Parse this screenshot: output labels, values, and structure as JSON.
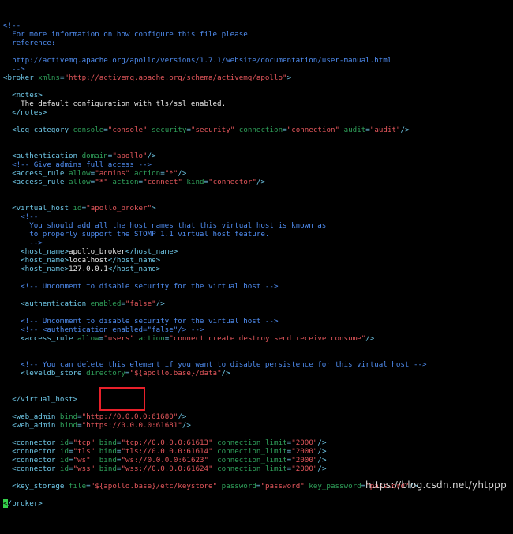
{
  "colors": {
    "background": "#000000",
    "comment": "#4f8cf0",
    "tag": "#6fc8e8",
    "attribute": "#2fa05a",
    "value": "#e4575c",
    "text": "#e6e6e6",
    "cursor": "#35d04a",
    "highlight_box": "#e8202a"
  },
  "lines": [
    [
      {
        "t": "<!--",
        "c": "comment"
      }
    ],
    [
      {
        "t": "  For more information on how configure this file please",
        "c": "comment"
      }
    ],
    [
      {
        "t": "  reference:",
        "c": "comment"
      }
    ],
    [],
    [
      {
        "t": "  http://activemq.apache.org/apollo/versions/1.7.1/website/documentation/user-manual.html",
        "c": "comment"
      }
    ],
    [
      {
        "t": "  -->",
        "c": "comment"
      }
    ],
    [
      {
        "t": "<broker ",
        "c": "tag"
      },
      {
        "t": "xmlns",
        "c": "attr"
      },
      {
        "t": "=",
        "c": "eq"
      },
      {
        "t": "\"http://activemq.apache.org/schema/activemq/apollo\"",
        "c": "val"
      },
      {
        "t": ">",
        "c": "tag"
      }
    ],
    [],
    [
      {
        "t": "  <notes>",
        "c": "tag"
      }
    ],
    [
      {
        "t": "    The default configuration with tls/ssl enabled.",
        "c": "text"
      }
    ],
    [
      {
        "t": "  </notes>",
        "c": "tag"
      }
    ],
    [],
    [
      {
        "t": "  <log_category ",
        "c": "tag"
      },
      {
        "t": "console",
        "c": "attr"
      },
      {
        "t": "=",
        "c": "eq"
      },
      {
        "t": "\"console\"",
        "c": "val"
      },
      {
        "t": " security",
        "c": "attr"
      },
      {
        "t": "=",
        "c": "eq"
      },
      {
        "t": "\"security\"",
        "c": "val"
      },
      {
        "t": " connection",
        "c": "attr"
      },
      {
        "t": "=",
        "c": "eq"
      },
      {
        "t": "\"connection\"",
        "c": "val"
      },
      {
        "t": " audit",
        "c": "attr"
      },
      {
        "t": "=",
        "c": "eq"
      },
      {
        "t": "\"audit\"",
        "c": "val"
      },
      {
        "t": "/>",
        "c": "tag"
      }
    ],
    [],
    [],
    [
      {
        "t": "  <authentication ",
        "c": "tag"
      },
      {
        "t": "domain",
        "c": "attr"
      },
      {
        "t": "=",
        "c": "eq"
      },
      {
        "t": "\"apollo\"",
        "c": "val"
      },
      {
        "t": "/>",
        "c": "tag"
      }
    ],
    [
      {
        "t": "  <!-- Give admins full access -->",
        "c": "comment"
      }
    ],
    [
      {
        "t": "  <access_rule ",
        "c": "tag"
      },
      {
        "t": "allow",
        "c": "attr"
      },
      {
        "t": "=",
        "c": "eq"
      },
      {
        "t": "\"admins\"",
        "c": "val"
      },
      {
        "t": " action",
        "c": "attr"
      },
      {
        "t": "=",
        "c": "eq"
      },
      {
        "t": "\"*\"",
        "c": "val"
      },
      {
        "t": "/>",
        "c": "tag"
      }
    ],
    [
      {
        "t": "  <access_rule ",
        "c": "tag"
      },
      {
        "t": "allow",
        "c": "attr"
      },
      {
        "t": "=",
        "c": "eq"
      },
      {
        "t": "\"*\"",
        "c": "val"
      },
      {
        "t": " action",
        "c": "attr"
      },
      {
        "t": "=",
        "c": "eq"
      },
      {
        "t": "\"connect\"",
        "c": "val"
      },
      {
        "t": " kind",
        "c": "attr"
      },
      {
        "t": "=",
        "c": "eq"
      },
      {
        "t": "\"connector\"",
        "c": "val"
      },
      {
        "t": "/>",
        "c": "tag"
      }
    ],
    [],
    [],
    [
      {
        "t": "  <virtual_host ",
        "c": "tag"
      },
      {
        "t": "id",
        "c": "attr"
      },
      {
        "t": "=",
        "c": "eq"
      },
      {
        "t": "\"apollo_broker\"",
        "c": "val"
      },
      {
        "t": ">",
        "c": "tag"
      }
    ],
    [
      {
        "t": "    <!--",
        "c": "comment"
      }
    ],
    [
      {
        "t": "      You should add all the host names that this virtual host is known as",
        "c": "comment"
      }
    ],
    [
      {
        "t": "      to properly support the STOMP 1.1 virtual host feature.",
        "c": "comment"
      }
    ],
    [
      {
        "t": "      -->",
        "c": "comment"
      }
    ],
    [
      {
        "t": "    <host_name>",
        "c": "tag"
      },
      {
        "t": "apollo_broker",
        "c": "text"
      },
      {
        "t": "</host_name>",
        "c": "tag"
      }
    ],
    [
      {
        "t": "    <host_name>",
        "c": "tag"
      },
      {
        "t": "localhost",
        "c": "text"
      },
      {
        "t": "</host_name>",
        "c": "tag"
      }
    ],
    [
      {
        "t": "    <host_name>",
        "c": "tag"
      },
      {
        "t": "127.0.0.1",
        "c": "text"
      },
      {
        "t": "</host_name>",
        "c": "tag"
      }
    ],
    [],
    [
      {
        "t": "    <!-- Uncomment to disable security for the virtual host -->",
        "c": "comment"
      }
    ],
    [],
    [
      {
        "t": "    <authentication ",
        "c": "tag"
      },
      {
        "t": "enabled",
        "c": "attr"
      },
      {
        "t": "=",
        "c": "eq"
      },
      {
        "t": "\"false\"",
        "c": "val"
      },
      {
        "t": "/>",
        "c": "tag"
      }
    ],
    [],
    [
      {
        "t": "    <!-- Uncomment to disable security for the virtual host -->",
        "c": "comment"
      }
    ],
    [
      {
        "t": "    <!-- <authentication enabled=\"false\"/> -->",
        "c": "comment"
      }
    ],
    [
      {
        "t": "    <access_rule ",
        "c": "tag"
      },
      {
        "t": "allow",
        "c": "attr"
      },
      {
        "t": "=",
        "c": "eq"
      },
      {
        "t": "\"users\"",
        "c": "val"
      },
      {
        "t": " action",
        "c": "attr"
      },
      {
        "t": "=",
        "c": "eq"
      },
      {
        "t": "\"connect create destroy send receive consume\"",
        "c": "val"
      },
      {
        "t": "/>",
        "c": "tag"
      }
    ],
    [],
    [],
    [
      {
        "t": "    <!-- You can delete this element if you want to disable persistence for this virtual host -->",
        "c": "comment"
      }
    ],
    [
      {
        "t": "    <leveldb_store ",
        "c": "tag"
      },
      {
        "t": "directory",
        "c": "attr"
      },
      {
        "t": "=",
        "c": "eq"
      },
      {
        "t": "\"${apollo.base}/data\"",
        "c": "val"
      },
      {
        "t": "/>",
        "c": "tag"
      }
    ],
    [],
    [],
    [
      {
        "t": "  </virtual_host>",
        "c": "tag"
      }
    ],
    [],
    [
      {
        "t": "  <web_admin ",
        "c": "tag"
      },
      {
        "t": "bind",
        "c": "attr"
      },
      {
        "t": "=",
        "c": "eq"
      },
      {
        "t": "\"http://0.0.0.0:61680\"",
        "c": "val"
      },
      {
        "t": "/>",
        "c": "tag"
      }
    ],
    [
      {
        "t": "  <web_admin ",
        "c": "tag"
      },
      {
        "t": "bind",
        "c": "attr"
      },
      {
        "t": "=",
        "c": "eq"
      },
      {
        "t": "\"https://0.0.0.0:61681\"",
        "c": "val"
      },
      {
        "t": "/>",
        "c": "tag"
      }
    ],
    [],
    [
      {
        "t": "  <connector ",
        "c": "tag"
      },
      {
        "t": "id",
        "c": "attr"
      },
      {
        "t": "=",
        "c": "eq"
      },
      {
        "t": "\"tcp\"",
        "c": "val"
      },
      {
        "t": " bind",
        "c": "attr"
      },
      {
        "t": "=",
        "c": "eq"
      },
      {
        "t": "\"tcp://0.0.0.0:61613\"",
        "c": "val"
      },
      {
        "t": " connection_limit",
        "c": "attr"
      },
      {
        "t": "=",
        "c": "eq"
      },
      {
        "t": "\"2000\"",
        "c": "val"
      },
      {
        "t": "/>",
        "c": "tag"
      }
    ],
    [
      {
        "t": "  <connector ",
        "c": "tag"
      },
      {
        "t": "id",
        "c": "attr"
      },
      {
        "t": "=",
        "c": "eq"
      },
      {
        "t": "\"tls\"",
        "c": "val"
      },
      {
        "t": " bind",
        "c": "attr"
      },
      {
        "t": "=",
        "c": "eq"
      },
      {
        "t": "\"tls://0.0.0.0:61614\"",
        "c": "val"
      },
      {
        "t": " connection_limit",
        "c": "attr"
      },
      {
        "t": "=",
        "c": "eq"
      },
      {
        "t": "\"2000\"",
        "c": "val"
      },
      {
        "t": "/>",
        "c": "tag"
      }
    ],
    [
      {
        "t": "  <connector ",
        "c": "tag"
      },
      {
        "t": "id",
        "c": "attr"
      },
      {
        "t": "=",
        "c": "eq"
      },
      {
        "t": "\"ws\"",
        "c": "val"
      },
      {
        "t": "  bind",
        "c": "attr"
      },
      {
        "t": "=",
        "c": "eq"
      },
      {
        "t": "\"ws://0.0.0.0:61623\"",
        "c": "val"
      },
      {
        "t": "  connection_limit",
        "c": "attr"
      },
      {
        "t": "=",
        "c": "eq"
      },
      {
        "t": "\"2000\"",
        "c": "val"
      },
      {
        "t": "/>",
        "c": "tag"
      }
    ],
    [
      {
        "t": "  <connector ",
        "c": "tag"
      },
      {
        "t": "id",
        "c": "attr"
      },
      {
        "t": "=",
        "c": "eq"
      },
      {
        "t": "\"wss\"",
        "c": "val"
      },
      {
        "t": " bind",
        "c": "attr"
      },
      {
        "t": "=",
        "c": "eq"
      },
      {
        "t": "\"wss://0.0.0.0:61624\"",
        "c": "val"
      },
      {
        "t": " connection_limit",
        "c": "attr"
      },
      {
        "t": "=",
        "c": "eq"
      },
      {
        "t": "\"2000\"",
        "c": "val"
      },
      {
        "t": "/>",
        "c": "tag"
      }
    ],
    [],
    [
      {
        "t": "  <key_storage ",
        "c": "tag"
      },
      {
        "t": "file",
        "c": "attr"
      },
      {
        "t": "=",
        "c": "eq"
      },
      {
        "t": "\"${apollo.base}/etc/keystore\"",
        "c": "val"
      },
      {
        "t": " password",
        "c": "attr"
      },
      {
        "t": "=",
        "c": "eq"
      },
      {
        "t": "\"password\"",
        "c": "val"
      },
      {
        "t": " key_password",
        "c": "attr"
      },
      {
        "t": "=",
        "c": "eq"
      },
      {
        "t": "\"password\"",
        "c": "val"
      },
      {
        "t": "/>",
        "c": "tag"
      }
    ],
    [],
    [
      {
        "t": "<",
        "c": "cursor"
      },
      {
        "t": "/broker>",
        "c": "tag"
      }
    ]
  ],
  "watermark": "https://blog.csdn.net/yhtppp"
}
